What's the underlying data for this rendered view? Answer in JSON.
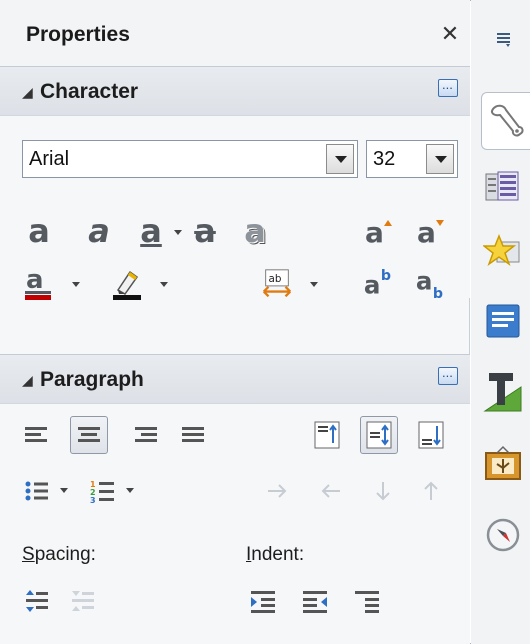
{
  "deck": {
    "title": "Properties",
    "close_symbol": "✕"
  },
  "character": {
    "header": "Character",
    "font_name": "Arial",
    "font_size": "32",
    "icons": [
      "bold-icon",
      "italic-icon",
      "underline-icon",
      "strikethrough-icon",
      "shadow-icon",
      "grow-font-icon",
      "shrink-font-icon",
      "font-color-icon",
      "highlighting-color-icon",
      "character-spacing-icon",
      "superscript-icon",
      "subscript-icon"
    ]
  },
  "paragraph": {
    "header": "Paragraph",
    "spacing_label_first": "S",
    "spacing_label_rest": "pacing:",
    "indent_label_first": "I",
    "indent_label_rest": "ndent:"
  },
  "colors": {
    "font_color": "#c00000",
    "highlight_color": "#ffd800",
    "accent_blue": "#2f6fc3"
  },
  "tabs": [
    "properties-tab",
    "styles-tab",
    "gallery-tab",
    "navigator-tab",
    "fontwork-tab",
    "media-tab",
    "compass-tab"
  ]
}
